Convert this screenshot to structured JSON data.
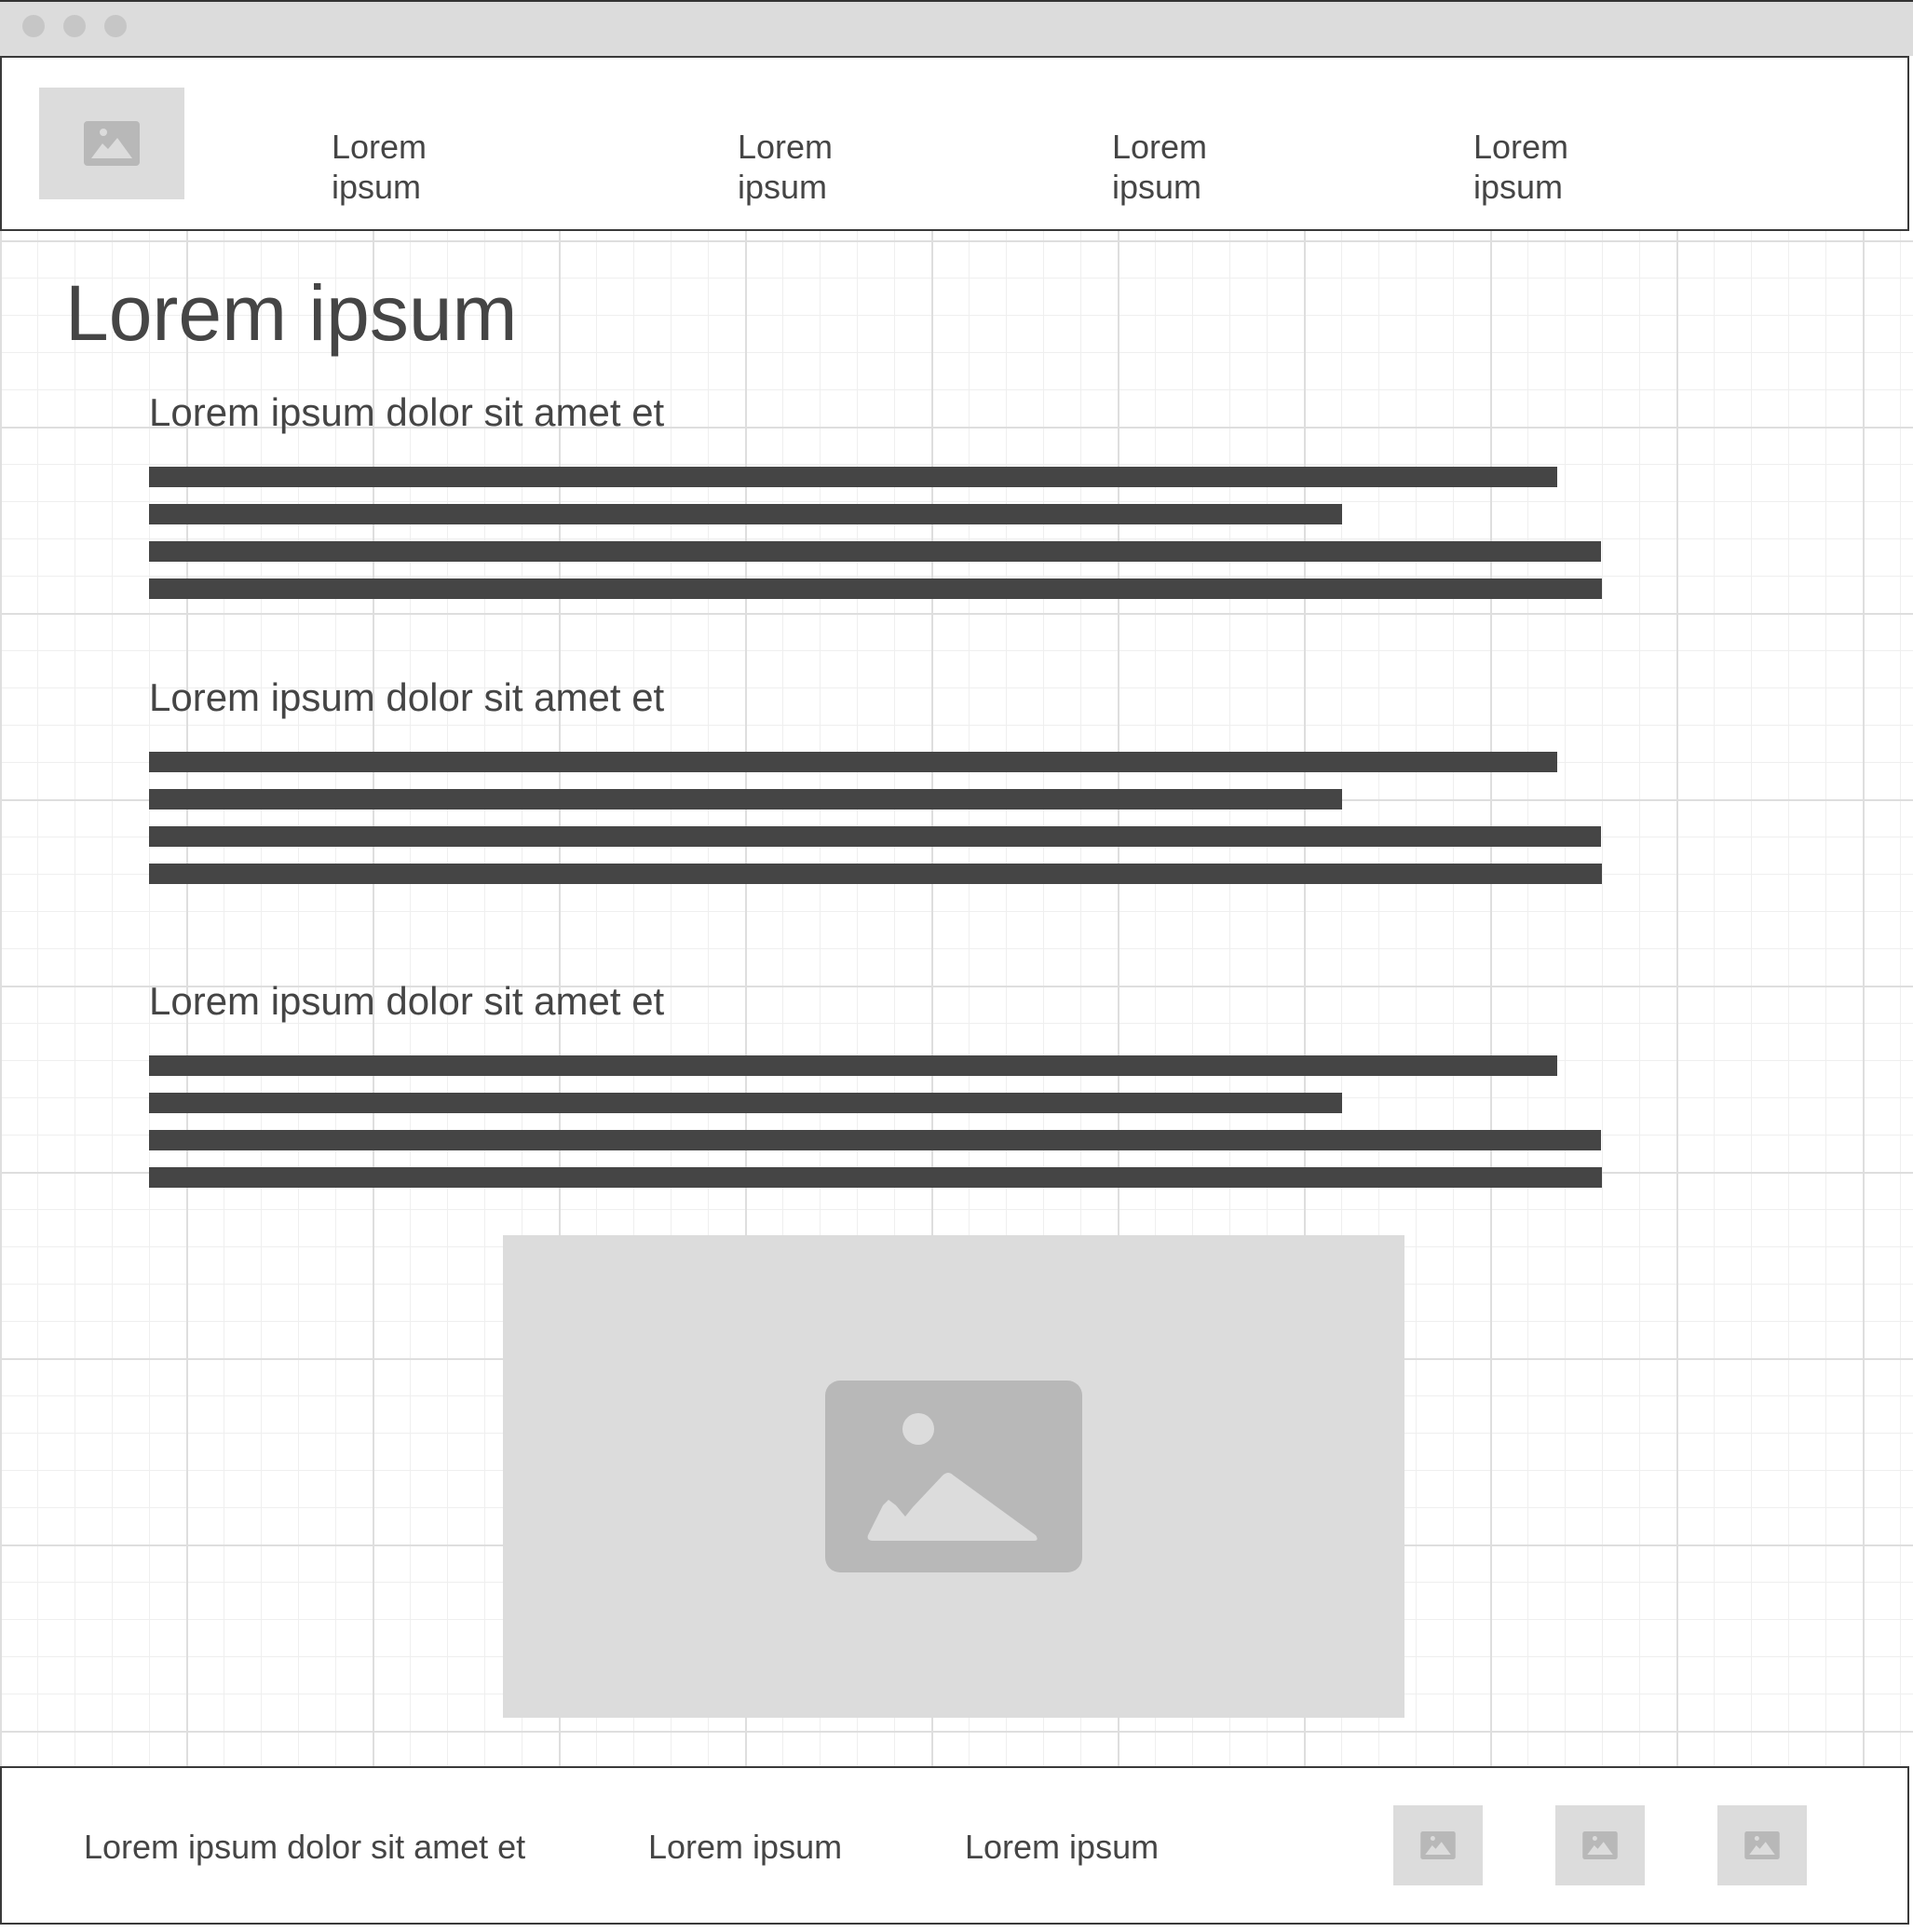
{
  "header": {
    "nav": [
      {
        "label": "Lorem\nipsum"
      },
      {
        "label": "Lorem\nipsum"
      },
      {
        "label": "Lorem\nipsum"
      },
      {
        "label": "Lorem\nipsum"
      }
    ]
  },
  "main": {
    "title": "Lorem ipsum",
    "sections": [
      {
        "heading": "Lorem ipsum dolor sit amet et"
      },
      {
        "heading": "Lorem ipsum dolor sit amet et"
      },
      {
        "heading": "Lorem ipsum dolor sit amet et"
      }
    ]
  },
  "footer": {
    "text": "Lorem ipsum dolor sit amet et",
    "links": [
      {
        "label": "Lorem ipsum"
      },
      {
        "label": "Lorem ipsum"
      }
    ],
    "icons": [
      "image-icon",
      "image-icon",
      "image-icon"
    ]
  },
  "colors": {
    "placeholder_bg": "#dcdcdc",
    "placeholder_icon": "#b8b8b8",
    "text": "#454545",
    "border": "#3a3a3a"
  }
}
